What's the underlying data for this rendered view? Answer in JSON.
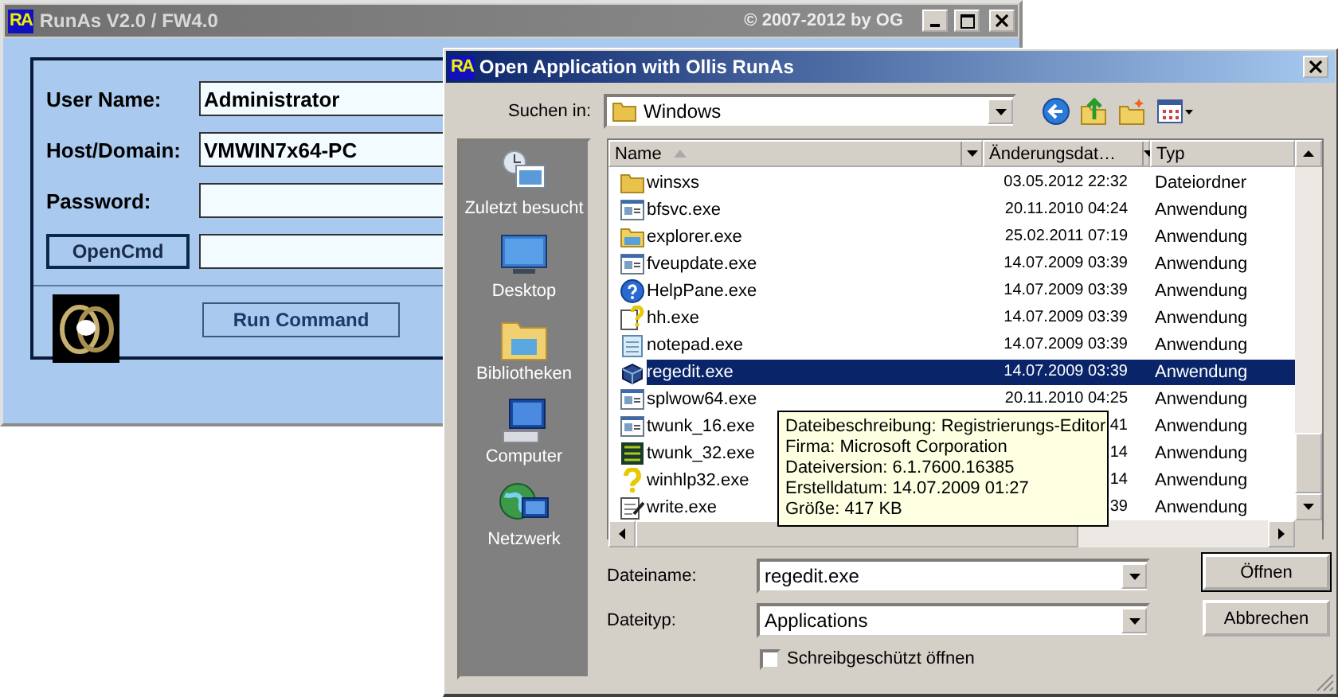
{
  "runas_window": {
    "logo": "RA",
    "title": "RunAs V2.0 / FW4.0",
    "copyright": "© 2007-2012 by OG",
    "fields": [
      {
        "label": "User Name:",
        "value": "Administrator"
      },
      {
        "label": "Host/Domain:",
        "value": "VMWIN7x64-PC"
      },
      {
        "label": "Password:"
      }
    ],
    "open_cmd_button": "OpenCmd",
    "run_button": "Run Command"
  },
  "dialog": {
    "logo": "RA",
    "title": "Open Application with Ollis RunAs",
    "look_in_label": "Suchen in:",
    "look_in_value": "Windows",
    "places": [
      {
        "kind": "recent",
        "label": "Zuletzt besucht"
      },
      {
        "kind": "desktop",
        "label": "Desktop"
      },
      {
        "kind": "libraries",
        "label": "Bibliotheken"
      },
      {
        "kind": "computer",
        "label": "Computer"
      },
      {
        "kind": "network",
        "label": "Netzwerk"
      }
    ],
    "columns": [
      "Name",
      "Änderungsdat…",
      "Typ"
    ],
    "files": [
      {
        "kind": "folder",
        "name": "winsxs",
        "date": "03.05.2012 22:32",
        "type": "Dateiordner",
        "selected": false
      },
      {
        "kind": "app",
        "name": "bfsvc.exe",
        "date": "20.11.2010 04:24",
        "type": "Anwendung",
        "selected": false
      },
      {
        "kind": "explorer",
        "name": "explorer.exe",
        "date": "25.02.2011 07:19",
        "type": "Anwendung",
        "selected": false
      },
      {
        "kind": "app",
        "name": "fveupdate.exe",
        "date": "14.07.2009 03:39",
        "type": "Anwendung",
        "selected": false
      },
      {
        "kind": "help",
        "name": "HelpPane.exe",
        "date": "14.07.2009 03:39",
        "type": "Anwendung",
        "selected": false
      },
      {
        "kind": "helpdoc",
        "name": "hh.exe",
        "date": "14.07.2009 03:39",
        "type": "Anwendung",
        "selected": false
      },
      {
        "kind": "notepad",
        "name": "notepad.exe",
        "date": "14.07.2009 03:39",
        "type": "Anwendung",
        "selected": false
      },
      {
        "kind": "regedit",
        "name": "regedit.exe",
        "date": "14.07.2009 03:39",
        "type": "Anwendung",
        "selected": true
      },
      {
        "kind": "app",
        "name": "splwow64.exe",
        "date": "20.11.2010 04:25",
        "type": "Anwendung",
        "selected": false
      },
      {
        "kind": "app",
        "name": "twunk_16.exe",
        "date": "41",
        "type": "Anwendung",
        "selected": false
      },
      {
        "kind": "grid",
        "name": "twunk_32.exe",
        "date": "14",
        "type": "Anwendung",
        "selected": false
      },
      {
        "kind": "question",
        "name": "winhlp32.exe",
        "date": "14",
        "type": "Anwendung",
        "selected": false
      },
      {
        "kind": "write",
        "name": "write.exe",
        "date": "39",
        "type": "Anwendung",
        "selected": false
      }
    ],
    "tooltip": [
      "Dateibeschreibung: Registrierungs-Editor",
      "Firma: Microsoft Corporation",
      "Dateiversion: 6.1.7600.16385",
      "Erstelldatum: 14.07.2009 01:27",
      "Größe: 417 KB"
    ],
    "filename_label": "Dateiname:",
    "filename_value": "regedit.exe",
    "filetype_label": "Dateityp:",
    "filetype_value": "Applications",
    "readonly": {
      "label": "Schreibgeschützt öffnen",
      "checked": false
    },
    "open_button": "Öffnen",
    "cancel_button": "Abbrechen"
  }
}
